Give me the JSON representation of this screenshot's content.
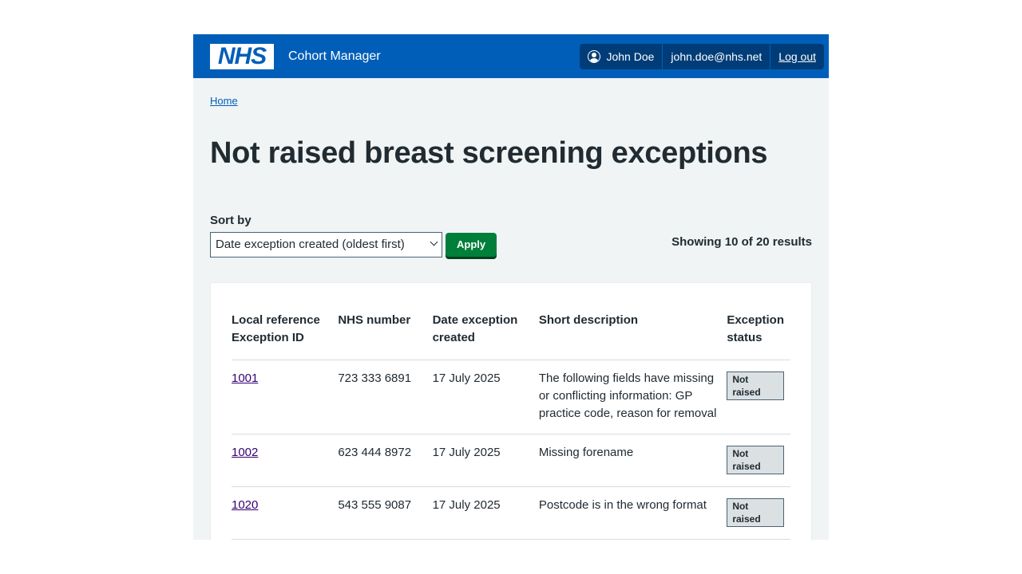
{
  "header": {
    "logo_text": "NHS",
    "service_name": "Cohort Manager",
    "user_name": "John Doe",
    "user_email": "john.doe@nhs.net",
    "logout_label": "Log out",
    "icons": {
      "user": "user-circle-icon"
    }
  },
  "breadcrumb": {
    "home_label": "Home"
  },
  "page": {
    "title": "Not raised breast screening exceptions"
  },
  "sort": {
    "label": "Sort by",
    "selected": "Date exception created (oldest first)",
    "apply_label": "Apply"
  },
  "results": {
    "summary": "Showing 10 of 20 results"
  },
  "table": {
    "headers": {
      "ref_line1": "Local reference",
      "ref_line2": "Exception ID",
      "nhs_number": "NHS number",
      "date_line1": "Date exception",
      "date_line2": "created",
      "description": "Short description",
      "status": "Exception status"
    },
    "rows": [
      {
        "id": "1001",
        "nhs_number": "723 333 6891",
        "date": "17 July 2025",
        "description": "The following fields have missing or conflicting information: GP practice code, reason for removal",
        "status": "Not raised"
      },
      {
        "id": "1002",
        "nhs_number": "623 444 8972",
        "date": "17 July 2025",
        "description": "Missing forename",
        "status": "Not raised"
      },
      {
        "id": "1020",
        "nhs_number": "543 555 9087",
        "date": "17 July 2025",
        "description": "Postcode is in the wrong format",
        "status": "Not raised"
      }
    ]
  },
  "colors": {
    "header_blue": "#005eb8",
    "account_bg": "#003d78",
    "apply_green": "#007f3b",
    "page_bg": "#f0f4f5",
    "visited_link": "#330072"
  }
}
